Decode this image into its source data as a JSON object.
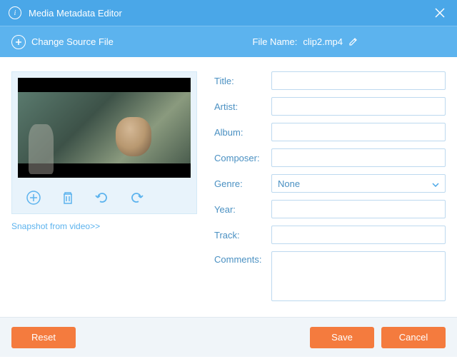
{
  "window": {
    "title": "Media Metadata Editor"
  },
  "toolbar": {
    "change_source_label": "Change Source File",
    "filename_label": "File Name:",
    "filename_value": "clip2.mp4"
  },
  "snapshot": {
    "link_text": "Snapshot from video>>"
  },
  "form": {
    "title": {
      "label": "Title:",
      "value": ""
    },
    "artist": {
      "label": "Artist:",
      "value": ""
    },
    "album": {
      "label": "Album:",
      "value": ""
    },
    "composer": {
      "label": "Composer:",
      "value": ""
    },
    "genre": {
      "label": "Genre:",
      "selected": "None"
    },
    "year": {
      "label": "Year:",
      "value": ""
    },
    "track": {
      "label": "Track:",
      "value": ""
    },
    "comments": {
      "label": "Comments:",
      "value": ""
    }
  },
  "footer": {
    "reset": "Reset",
    "save": "Save",
    "cancel": "Cancel"
  }
}
